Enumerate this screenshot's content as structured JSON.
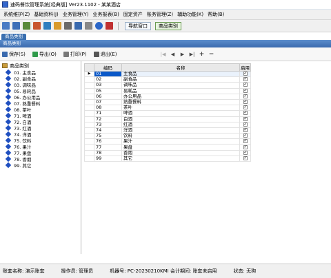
{
  "window": {
    "title": "速码餐饮管理系统[经典版] Ver23.1102 - 某某酒店"
  },
  "menu": [
    "系统维护(Z)",
    "基础资料(J)",
    "业务管理(Y)",
    "业务报表(B)",
    "固定资产",
    "账务管理(Z)",
    "辅助功能(K)",
    "帮助(B)"
  ],
  "toolbar": {
    "nav_window_label": "导航窗口",
    "category_label": "商品类别"
  },
  "doc_tab": "商品类别",
  "actions": {
    "save": "保存(S)",
    "export": "导出(O)",
    "print": "打印(P)",
    "exit": "退出(E)"
  },
  "pager": [
    "|◀",
    "◀",
    "▶",
    "▶|",
    "+",
    "−"
  ],
  "tree": {
    "root": "商品类别",
    "items": [
      "01. 主食品",
      "02. 副食品",
      "03. 调味品",
      "05. 易耗品",
      "06. 办公用品",
      "07. 熟重餐料",
      "08. 茶叶",
      "71. 啤酒",
      "72. 白酒",
      "73. 红酒",
      "74. 洋酒",
      "75. 饮料",
      "76. 果汁",
      "77. 果盘",
      "78. 香烟",
      "99. 其它"
    ]
  },
  "grid": {
    "columns": [
      "编码",
      "名称",
      "启用"
    ],
    "rows": [
      {
        "code": "01",
        "name": "主食品",
        "enabled": true
      },
      {
        "code": "02",
        "name": "副食品",
        "enabled": true
      },
      {
        "code": "03",
        "name": "调味品",
        "enabled": true
      },
      {
        "code": "05",
        "name": "易耗品",
        "enabled": true
      },
      {
        "code": "06",
        "name": "办公用品",
        "enabled": true
      },
      {
        "code": "07",
        "name": "熟重餐料",
        "enabled": true
      },
      {
        "code": "08",
        "name": "茶叶",
        "enabled": true
      },
      {
        "code": "71",
        "name": "啤酒",
        "enabled": true
      },
      {
        "code": "72",
        "name": "白酒",
        "enabled": true
      },
      {
        "code": "73",
        "name": "红酒",
        "enabled": true
      },
      {
        "code": "74",
        "name": "洋酒",
        "enabled": true
      },
      {
        "code": "75",
        "name": "饮料",
        "enabled": true
      },
      {
        "code": "76",
        "name": "果汁",
        "enabled": true
      },
      {
        "code": "77",
        "name": "果盘",
        "enabled": true
      },
      {
        "code": "78",
        "name": "香烟",
        "enabled": true
      },
      {
        "code": "99",
        "name": "其它",
        "enabled": true
      }
    ]
  },
  "status": {
    "account": "账套名称: 演示账套",
    "operator": "操作员: 管理员",
    "machine": "机器号: PC-20230210KMI 会计期间: 账套未启用",
    "state": "状态: 无狗"
  },
  "colors": {
    "selection": "#0a58c8",
    "panel_header": "#3a6aae",
    "tree_diamond": "#2050c0"
  }
}
